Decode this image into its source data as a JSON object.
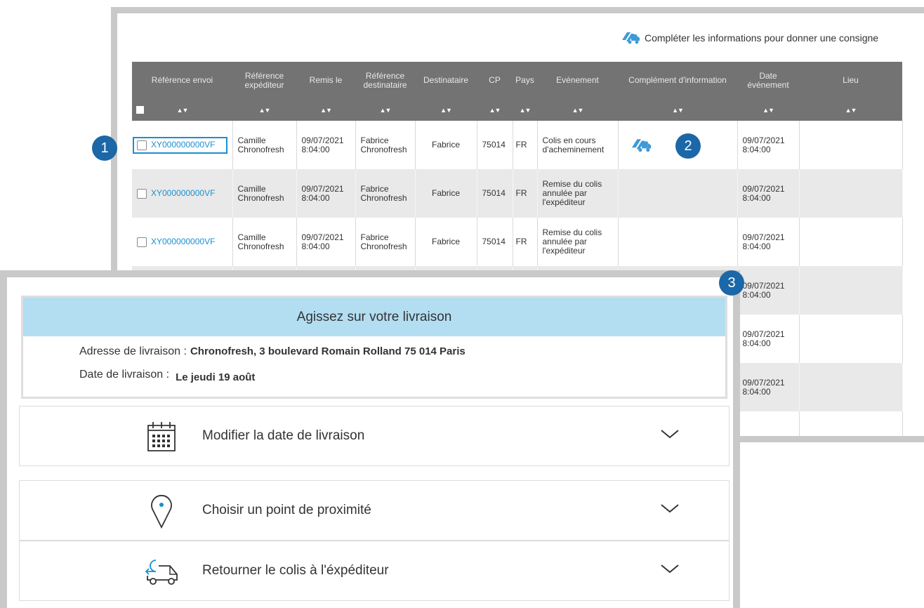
{
  "header_hint": "Compléter les informations pour donner une consigne",
  "table": {
    "columns": [
      "Référence envoi",
      "Référence expéditeur",
      "Remis le",
      "Référence destinataire",
      "Destinataire",
      "CP",
      "Pays",
      "Evénement",
      "Complément d'information",
      "Date événement",
      "Lieu"
    ],
    "sort_glyph": "▲▼",
    "rows": [
      {
        "ref": "XY000000000VF",
        "exp": "Camille Chronofresh",
        "remis": "09/07/2021 8:04:00",
        "dest_ref": "Fabrice Chronofresh",
        "dest": "Fabrice",
        "cp": "75014",
        "pays": "FR",
        "event": "Colis en cours d'acheminement",
        "complement_icon": "delivery-truck-icon",
        "date_event": "09/07/2021 8:04:00",
        "lieu": ""
      },
      {
        "ref": "XY000000000VF",
        "exp": "Camille Chronofresh",
        "remis": "09/07/2021 8:04:00",
        "dest_ref": "Fabrice Chronofresh",
        "dest": "Fabrice",
        "cp": "75014",
        "pays": "FR",
        "event": "Remise du colis annulée par l'expéditeur",
        "date_event": "09/07/2021 8:04:00",
        "lieu": ""
      },
      {
        "ref": "XY000000000VF",
        "exp": "Camille Chronofresh",
        "remis": "09/07/2021 8:04:00",
        "dest_ref": "Fabrice Chronofresh",
        "dest": "Fabrice",
        "cp": "75014",
        "pays": "FR",
        "event": "Remise du colis annulée par l'expéditeur",
        "date_event": "09/07/2021 8:04:00",
        "lieu": ""
      },
      {
        "date_event": "09/07/2021 8:04:00"
      },
      {
        "date_event": "09/07/2021 8:04:00"
      },
      {
        "date_event": "09/07/2021 8:04:00"
      }
    ]
  },
  "badges": [
    "1",
    "2",
    "3"
  ],
  "panel": {
    "title": "Agissez sur votre livraison",
    "address_label": "Adresse de livraison :",
    "address_value": "Chronofresh, 3 boulevard Romain Rolland 75 014 Paris",
    "date_label": "Date de livraison :",
    "date_value": "Le jeudi 19 août",
    "actions": [
      {
        "label": "Modifier la date de livraison",
        "icon": "calendar-icon"
      },
      {
        "label": "Choisir un point de proximité",
        "icon": "location-pin-icon"
      },
      {
        "label": "Retourner le colis à l'éxpéditeur",
        "icon": "return-truck-icon"
      }
    ]
  },
  "colors": {
    "accent": "#1a8fd1",
    "badge": "#1b67a8",
    "header_bg": "#737373",
    "panel_title_bg": "#b3def2",
    "row_alt": "#e9e9e9"
  }
}
